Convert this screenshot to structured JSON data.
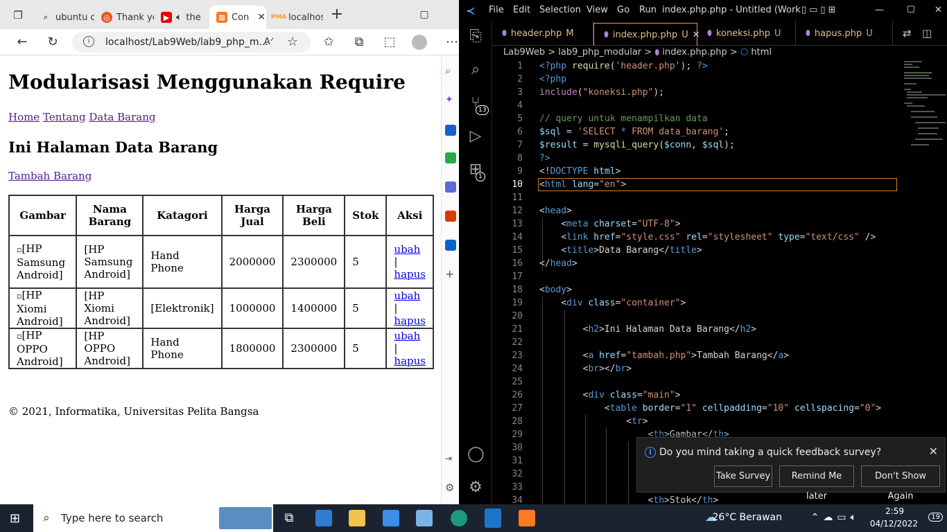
{
  "browser": {
    "tabs": [
      {
        "label": "ubuntu c",
        "icon": "search-icon"
      },
      {
        "label": "Thank yo",
        "icon": "ubuntu-icon"
      },
      {
        "label": "the",
        "icon": "youtube-icon"
      },
      {
        "label": "Con",
        "icon": "xampp-icon"
      },
      {
        "label": "localhos",
        "icon": "phpmyadmin-icon"
      }
    ],
    "address": "localhost/Lab9Web/lab9_php_m...",
    "page": {
      "title": "Modularisasi Menggunakan Require",
      "nav": [
        "Home",
        "Tentang",
        "Data Barang"
      ],
      "heading": "Ini Halaman Data Barang",
      "add_link": "Tambah Barang",
      "table": {
        "headers": [
          "Gambar",
          "Nama Barang",
          "Katagori",
          "Harga Jual",
          "Harga Beli",
          "Stok",
          "Aksi"
        ],
        "rows": [
          {
            "gambar": "[HP Samsung Android]",
            "nama": "[HP Samsung Android]",
            "kategori": "Hand Phone",
            "jual": "2000000",
            "beli": "2300000",
            "stok": "5"
          },
          {
            "gambar": "[HP Xiomi Android]",
            "nama": "[HP Xiomi Android]",
            "kategori": "[Elektronik]",
            "jual": "1000000",
            "beli": "1400000",
            "stok": "5"
          },
          {
            "gambar": "[HP OPPO Android]",
            "nama": "[HP OPPO Android]",
            "kategori": "Hand Phone",
            "jual": "1800000",
            "beli": "2300000",
            "stok": "5"
          }
        ],
        "action_edit": "ubah",
        "action_sep": "|",
        "action_delete": "hapus"
      },
      "footer": "© 2021, Informatika, Universitas Pelita Bangsa"
    }
  },
  "vscode": {
    "menu": [
      "File",
      "Edit",
      "Selection",
      "View",
      "Go",
      "Run"
    ],
    "window_title": "index.php.php - Untitled (Workspac...",
    "tabs": [
      {
        "label": "header.php",
        "status": "M"
      },
      {
        "label": "index.php.php",
        "status": "U"
      },
      {
        "label": "koneksi.php",
        "status": "U"
      },
      {
        "label": "hapus.php",
        "status": "U"
      }
    ],
    "breadcrumb": [
      "Lab9Web",
      "lab9_php_modular",
      "index.php.php",
      "html"
    ],
    "scm_badge": "13",
    "ext_badge": "1",
    "notification": {
      "message": "Do you mind taking a quick feedback survey?",
      "buttons": [
        "Take Survey",
        "Remind Me later",
        "Don't Show Again"
      ]
    }
  },
  "taskbar": {
    "search_placeholder": "Type here to search",
    "weather": "26°C  Berawan",
    "time": "2:59",
    "date": "04/12/2022",
    "notif_count": "19"
  }
}
